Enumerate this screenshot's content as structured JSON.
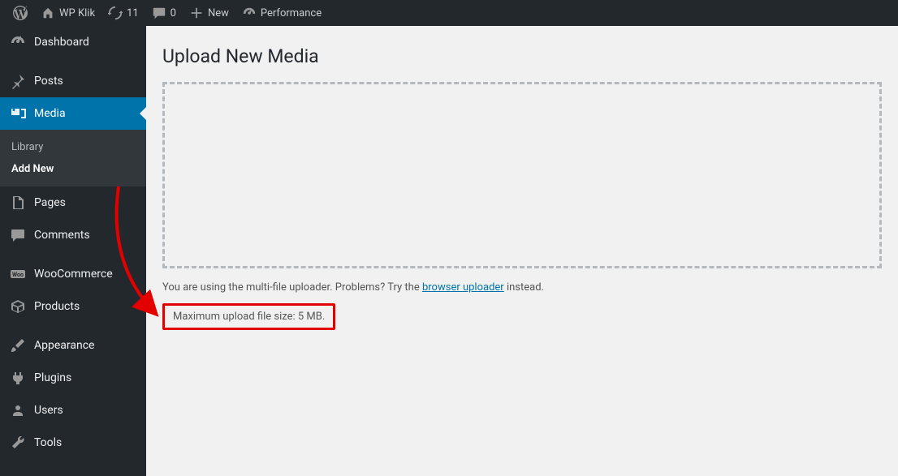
{
  "toolbar": {
    "site_name": "WP Klik",
    "updates": "11",
    "comments": "0",
    "new": "New",
    "performance": "Performance"
  },
  "sidebar": {
    "dashboard": "Dashboard",
    "posts": "Posts",
    "media": "Media",
    "media_sub_library": "Library",
    "media_sub_addnew": "Add New",
    "pages": "Pages",
    "comments": "Comments",
    "woocommerce": "WooCommerce",
    "products": "Products",
    "appearance": "Appearance",
    "plugins": "Plugins",
    "users": "Users",
    "tools": "Tools"
  },
  "main": {
    "title": "Upload New Media",
    "helper_prefix": "You are using the multi-file uploader. Problems? Try the ",
    "helper_link": "browser uploader",
    "helper_suffix": " instead.",
    "max_size": "Maximum upload file size: 5 MB."
  }
}
